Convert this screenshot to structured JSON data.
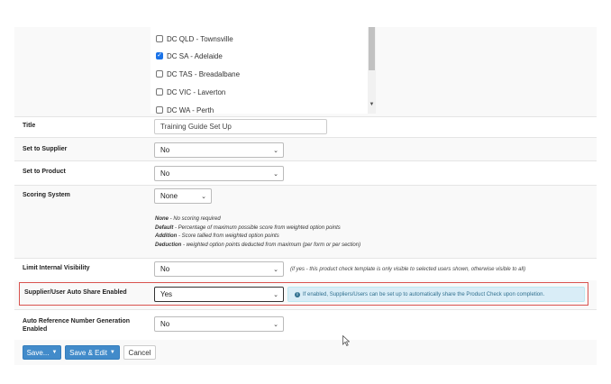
{
  "stores_list": {
    "items": [
      {
        "label": "DC QLD - Townsville",
        "checked": false
      },
      {
        "label": "DC SA - Adelaide",
        "checked": true
      },
      {
        "label": "DC TAS - Breadalbane",
        "checked": false
      },
      {
        "label": "DC VIC - Laverton",
        "checked": false
      },
      {
        "label": "DC WA - Perth",
        "checked": false
      }
    ]
  },
  "fields": {
    "title": {
      "label": "Title",
      "value": "Training Guide Set Up"
    },
    "set_to_supplier": {
      "label": "Set to Supplier",
      "value": "No"
    },
    "set_to_product": {
      "label": "Set to Product",
      "value": "No"
    },
    "scoring_system": {
      "label": "Scoring System",
      "value": "None",
      "notes": [
        {
          "term": "None",
          "desc": " - No scoring required"
        },
        {
          "term": "Default",
          "desc": " - Percentage of maximum possible score from weighted option points"
        },
        {
          "term": "Addition",
          "desc": " - Score tallied from weighted option points"
        },
        {
          "term": "Deduction",
          "desc": " - weighted option points deducted from maximum (per form or per section)"
        }
      ]
    },
    "limit_visibility": {
      "label": "Limit Internal Visibility",
      "value": "No",
      "hint": "(if yes - this product check template is only visible to selected users shown, otherwise visible to all)"
    },
    "auto_share": {
      "label": "Supplier/User Auto Share Enabled",
      "value": "Yes",
      "info_icon": "info-circle-icon",
      "info": "If enabled, Suppliers/Users can be set up to automatically share the Product Check upon completion."
    },
    "auto_reference": {
      "label_line1": "Auto Reference Number Generation",
      "label_line2": "Enabled",
      "value": "No"
    }
  },
  "actions": {
    "save_label": "Save...",
    "save_edit_label": "Save & Edit",
    "cancel_label": "Cancel"
  },
  "colors": {
    "primary": "#428bca",
    "highlight_border": "#d9534f",
    "info_bg": "#d9edf7",
    "info_text": "#31708f",
    "checkbox_checked": "#1a73e8"
  }
}
